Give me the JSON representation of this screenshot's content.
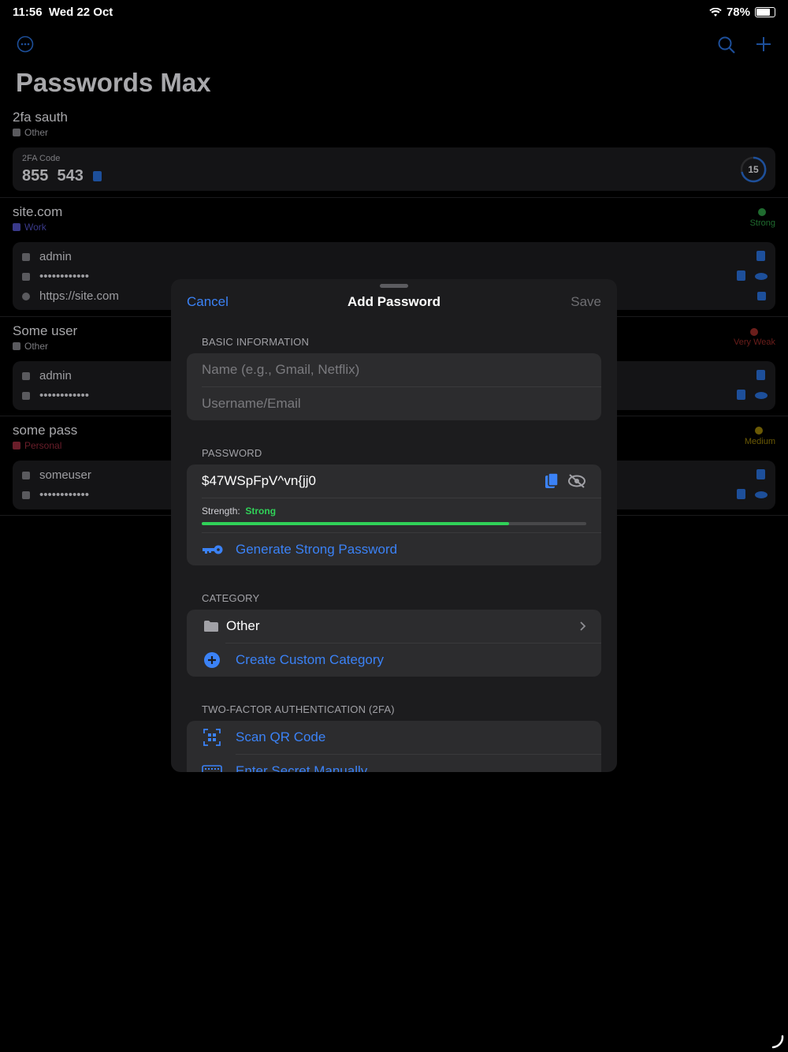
{
  "status_bar": {
    "time": "11:56",
    "date": "Wed 22 Oct",
    "battery": "78%"
  },
  "app": {
    "title": "Passwords Max"
  },
  "entries": [
    {
      "title": "2fa sauth",
      "category": "Other",
      "twofa_label": "2FA Code",
      "twofa_code_a": "855",
      "twofa_code_b": "543",
      "countdown": "15"
    },
    {
      "title": "site.com",
      "category": "Work",
      "strength": "Strong",
      "username": "admin",
      "password": "••••••••••••",
      "url": "https://site.com"
    },
    {
      "title": "Some user",
      "category": "Other",
      "strength": "Very Weak",
      "username": "admin",
      "password": "••••••••••••"
    },
    {
      "title": "some pass",
      "category": "Personal",
      "strength": "Medium",
      "username": "someuser",
      "password": "••••••••••••"
    }
  ],
  "sheet": {
    "cancel": "Cancel",
    "title": "Add Password",
    "save": "Save",
    "basic_header": "BASIC INFORMATION",
    "name_placeholder": "Name (e.g., Gmail, Netflix)",
    "username_placeholder": "Username/Email",
    "password_header": "PASSWORD",
    "password_value": "$47WSpFpV^vn{jj0",
    "strength_label": "Strength:",
    "strength_value": "Strong",
    "strength_fraction": 0.8,
    "generate": "Generate Strong Password",
    "category_header": "CATEGORY",
    "category_value": "Other",
    "create_category": "Create Custom Category",
    "twofa_header": "TWO-FACTOR AUTHENTICATION (2FA)",
    "scan_qr": "Scan QR Code",
    "enter_secret": "Enter Secret Manually"
  },
  "colors": {
    "accent": "#3b82f6",
    "strong": "#30d158",
    "very_weak": "#ff453a",
    "medium": "#ffd60a",
    "work": "#5e5ce6",
    "personal": "#ff375f"
  }
}
